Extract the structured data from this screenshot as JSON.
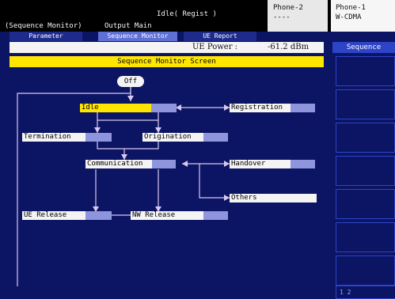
{
  "header": {
    "mode": "(Sequence Monitor)",
    "output": "Output Main",
    "state": "Idle( Regist )",
    "phone2": {
      "label": "Phone-2",
      "value": "----"
    },
    "phone1": {
      "label": "Phone-1",
      "value": "W-CDMA"
    }
  },
  "tabs": {
    "parameter": "Parameter",
    "sequence_monitor": "Sequence Monitor",
    "ue_report": "UE Report"
  },
  "power": {
    "label": "UE Power :",
    "value": "-61.2 dBm"
  },
  "screen_title": "Sequence Monitor Screen",
  "side_panel": {
    "title": "Sequence",
    "page": "1  2"
  },
  "flow": {
    "off": "Off",
    "idle": "Idle",
    "registration": "Registration",
    "termination": "Termination",
    "origination": "Origination",
    "communication": "Communication",
    "handover": "Handover",
    "others": "Others",
    "ue_release": "UE Release",
    "nw_release": "NW Release"
  },
  "colors": {
    "background": "#0c1464",
    "highlight": "#ffe600",
    "status_block": "#8e95dd",
    "line": "#d8c8f0"
  }
}
